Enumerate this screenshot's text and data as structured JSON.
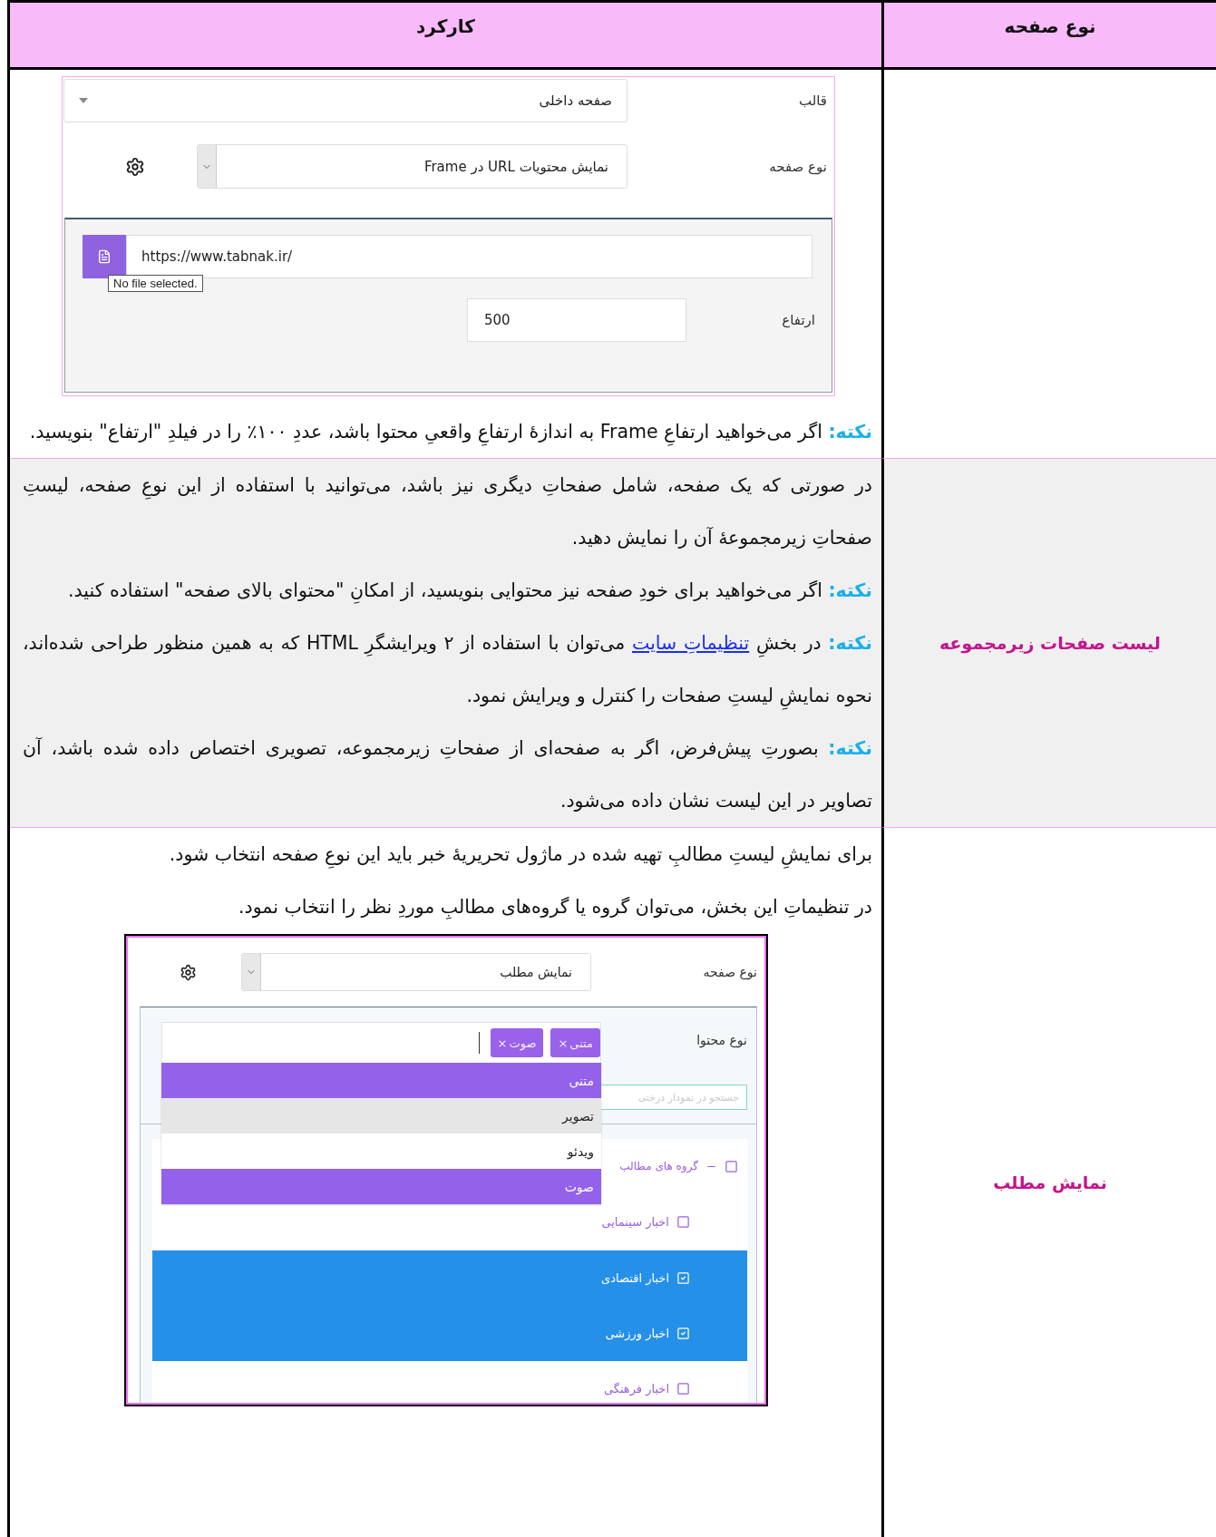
{
  "table": {
    "headers": [
      {
        "label": "نوع صفحه"
      },
      {
        "label": "کارکرد"
      }
    ],
    "rows": [
      {
        "shaded": false,
        "blocks": [
          {
            "kind": "frame_form",
            "template_label": "قالب",
            "template_value": "صفحه داخلی",
            "page_type_label": "نوع صفحه",
            "page_type_value": "نمایش محتویات URL در Frame",
            "url": "https://www.tabnak.ir/",
            "tooltip": "No file selected.",
            "height_label": "ارتفاع",
            "height_value": "500"
          },
          {
            "kind": "note",
            "label": "نکته:",
            "text": "اگر می‌خواهید ارتفاعِ Frame به اندازهٔ ارتفاعِ واقعیِ محتوا باشد، عددِ ۱۰۰٪ را در فیلدِ \"ارتفاع\" بنویسید."
          }
        ]
      },
      {
        "shaded": true,
        "page_type": "لیست صفحات زیرمجموعه",
        "blocks": [
          {
            "kind": "text",
            "text": "در صورتی که یک صفحه، شامل صفحاتِ دیگری نیز باشد، می‌توانید با استفاده از این نوعِ صفحه، لیستِ صفحاتِ زیرمجموعهٔ آن را نمایش دهید."
          },
          {
            "kind": "note",
            "label": "نکته:",
            "text": "اگر می‌خواهید برای خودِ صفحه نیز محتوایی بنویسید، از امکانِ \"محتوای بالای صفحه\" استفاده کنید."
          },
          {
            "kind": "link_note",
            "label": "نکته:",
            "before": "در بخشِ",
            "link": "تنظیماتِ سایت",
            "after": "می‌توان با استفاده از ۲ ویرایشگرِ HTML که به همین منظور طراحی شده‌اند، نحوه نمایشِ لیستِ صفحات را کنترل و ویرایش نمود."
          },
          {
            "kind": "note",
            "label": "نکته:",
            "text": "بصورتِ پیش‌فرض، اگر به صفحه‌ای از صفحاتِ زیرمجموعه، تصویری اختصاص داده شده باشد، آن تصاویر در این لیست نشان داده می‌شود."
          }
        ]
      },
      {
        "shaded": false,
        "page_type": "نمایش مطلب",
        "blocks": [
          {
            "kind": "text",
            "text": "برای نمایشِ لیستِ مطالبِ تهیه شده در ماژول تحریریهٔ خبر باید این نوعِ صفحه انتخاب شود."
          },
          {
            "kind": "text",
            "text": "در تنظیماتِ این بخش، می‌توان گروه یا گروه‌های مطالبِ موردِ نظر را انتخاب نمود."
          },
          {
            "kind": "content_form",
            "page_type_label": "نوع صفحه",
            "page_type_value": "نمایش مطلب",
            "content_type_label": "نوع محتوا",
            "tags": [
              {
                "label": "متنی",
                "remove": "×"
              },
              {
                "label": "صوت",
                "remove": "×"
              }
            ],
            "options": [
              {
                "label": "متنی",
                "selected": true,
                "highlighted": false
              },
              {
                "label": "تصویر",
                "selected": false,
                "highlighted": true
              },
              {
                "label": "ویدئو",
                "selected": false,
                "highlighted": false
              },
              {
                "label": "صوت",
                "selected": true,
                "highlighted": false
              }
            ],
            "search_placeholder": "جستجو در نمودار درختی",
            "tree": {
              "label": "گروه های مطالب",
              "checked": false,
              "expanded": true,
              "children": [
                {
                  "label": "اخبار سینمایی",
                  "checked": false
                },
                {
                  "label": "اخبار اقتصادی",
                  "checked": true
                },
                {
                  "label": "اخبار ورزشی",
                  "checked": true
                },
                {
                  "label": "اخبار فرهنگی",
                  "checked": false
                }
              ]
            }
          }
        ]
      }
    ]
  }
}
